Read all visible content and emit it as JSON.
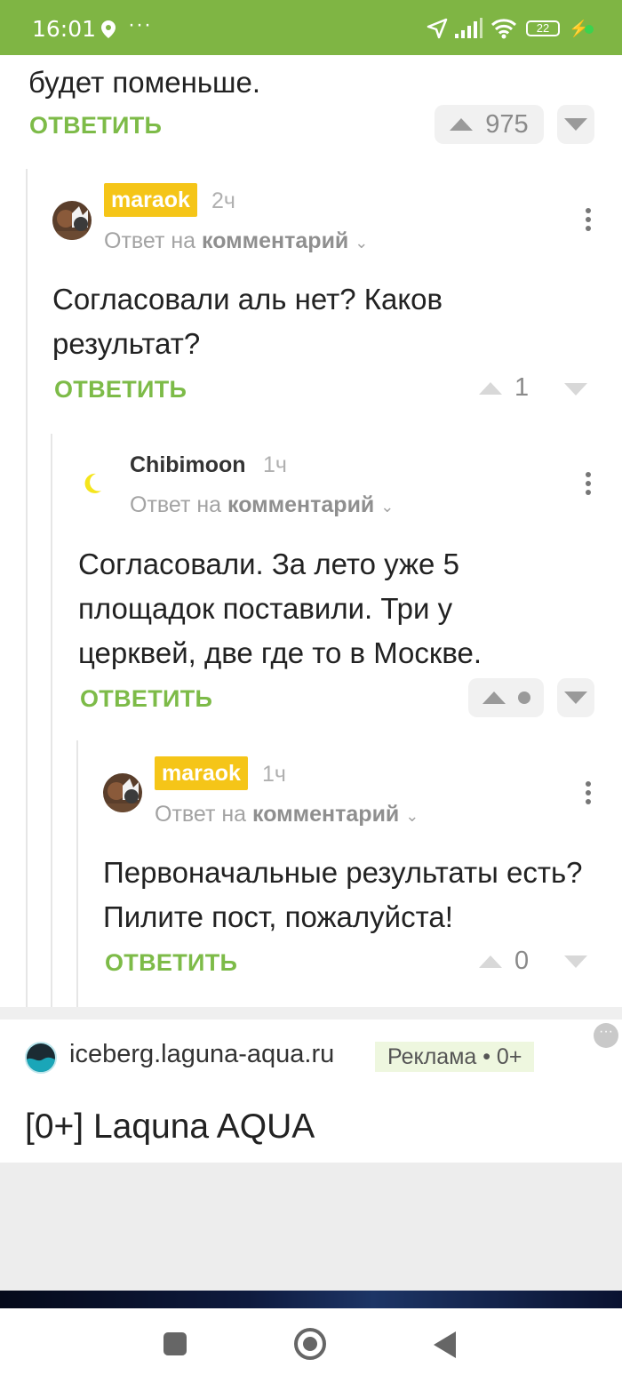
{
  "status_bar": {
    "time": "16:01",
    "dots": "···",
    "battery": "22"
  },
  "top_comment": {
    "text_tail": "будет поменьше.",
    "reply_label": "ОТВЕТИТЬ",
    "votes": "975"
  },
  "comments": [
    {
      "username": "maraok",
      "time": "2ч",
      "reply_to_prefix": "Ответ на",
      "reply_to_target": "комментарий",
      "text": "Согласовали аль нет? Каков результат?",
      "reply_label": "ОТВЕТИТЬ",
      "votes": "1"
    },
    {
      "username": "Chibimoon",
      "time": "1ч",
      "reply_to_prefix": "Ответ на",
      "reply_to_target": "комментарий",
      "text": "Согласовали. За лето уже 5 площадок поставили. Три у церквей, две где то в Москве.",
      "reply_label": "ОТВЕТИТЬ"
    },
    {
      "username": "maraok",
      "time": "1ч",
      "reply_to_prefix": "Ответ на",
      "reply_to_target": "комментарий",
      "text": "Первоначальные результаты есть? Пилите пост, пожалуйста!",
      "reply_label": "ОТВЕТИТЬ",
      "votes": "0"
    }
  ],
  "ad": {
    "domain": "iceberg.laguna-aqua.ru",
    "label": "Реклама • 0+",
    "title": "[0+] Laquna AQUA",
    "more": "···"
  },
  "colors": {
    "accent": "#7dbb48",
    "status_bar": "#7fb544",
    "badge": "#f5c518"
  }
}
